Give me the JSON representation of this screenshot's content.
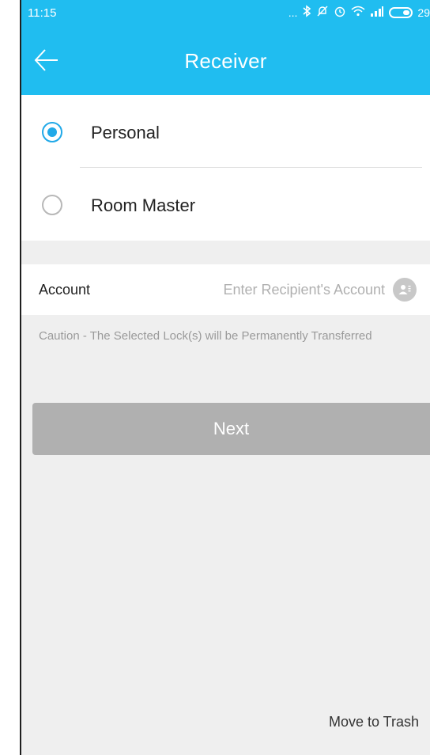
{
  "status_bar": {
    "time": "11:15",
    "notif_dots": "...",
    "battery": "29"
  },
  "app_bar": {
    "title": "Receiver",
    "back_icon": "arrow-left-icon"
  },
  "receiver_options": [
    {
      "label": "Personal",
      "selected": true
    },
    {
      "label": "Room Master",
      "selected": false
    }
  ],
  "account": {
    "label": "Account",
    "value": "",
    "placeholder": "Enter Recipient's Account",
    "contact_icon": "contact-book-icon"
  },
  "caution": "Caution - The Selected Lock(s) will be Permanently Transferred",
  "next_button": "Next",
  "move_to_trash": "Move to Trash",
  "colors": {
    "accent": "#20bdf0",
    "radio_selected": "#21a9e8",
    "button_disabled": "#b0b0b0",
    "background": "#efefef"
  }
}
